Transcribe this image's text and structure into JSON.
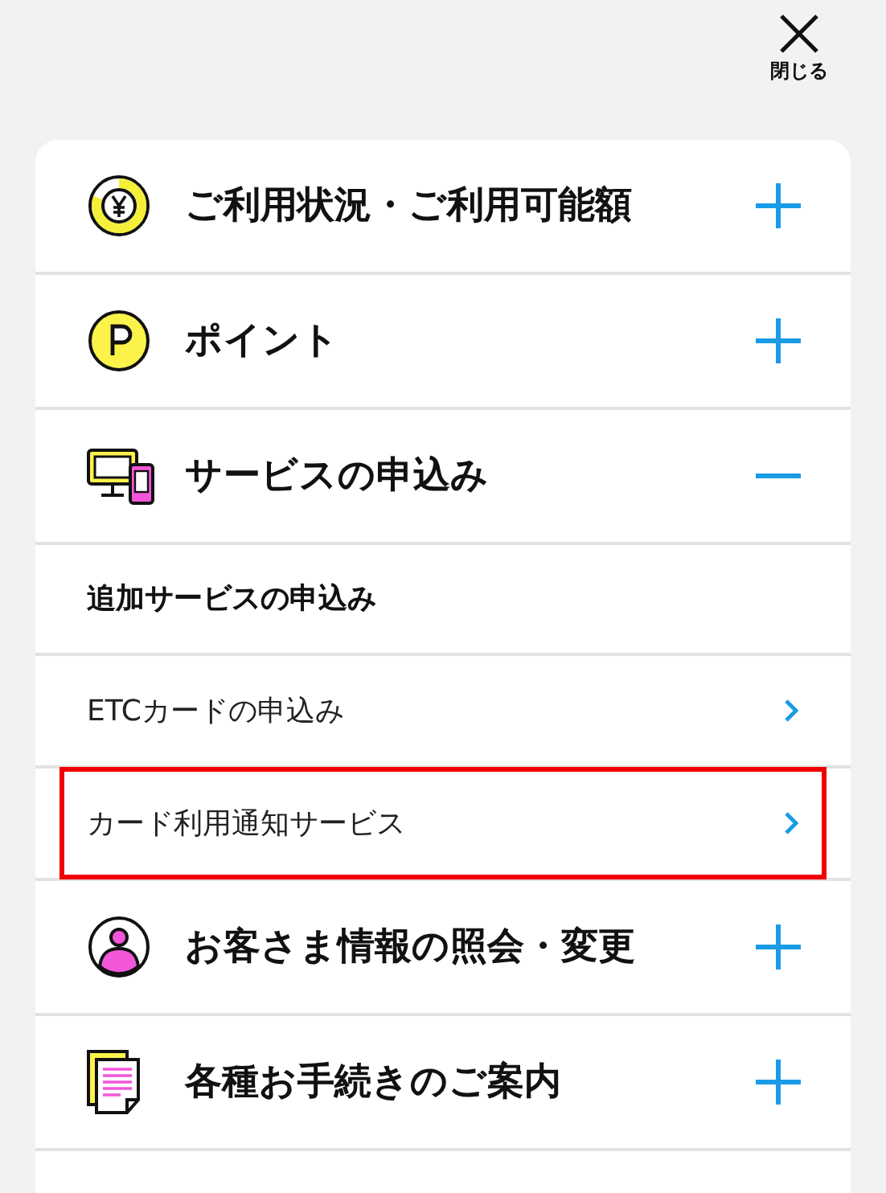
{
  "close_button": {
    "label": "閉じる"
  },
  "sections": [
    {
      "kind": "usage",
      "title": "ご利用状況・ご利用可能額",
      "expanded": false
    },
    {
      "kind": "points",
      "title": "ポイント",
      "expanded": false
    },
    {
      "kind": "services",
      "title": "サービスの申込み",
      "expanded": true,
      "subheading": "追加サービスの申込み",
      "items": [
        {
          "label": "ETCカードの申込み",
          "highlighted": false
        },
        {
          "label": "カード利用通知サービス",
          "highlighted": true
        }
      ]
    },
    {
      "kind": "profile",
      "title": "お客さま情報の照会・変更",
      "expanded": false
    },
    {
      "kind": "procedures",
      "title": "各種お手続きのご案内",
      "expanded": false
    }
  ]
}
